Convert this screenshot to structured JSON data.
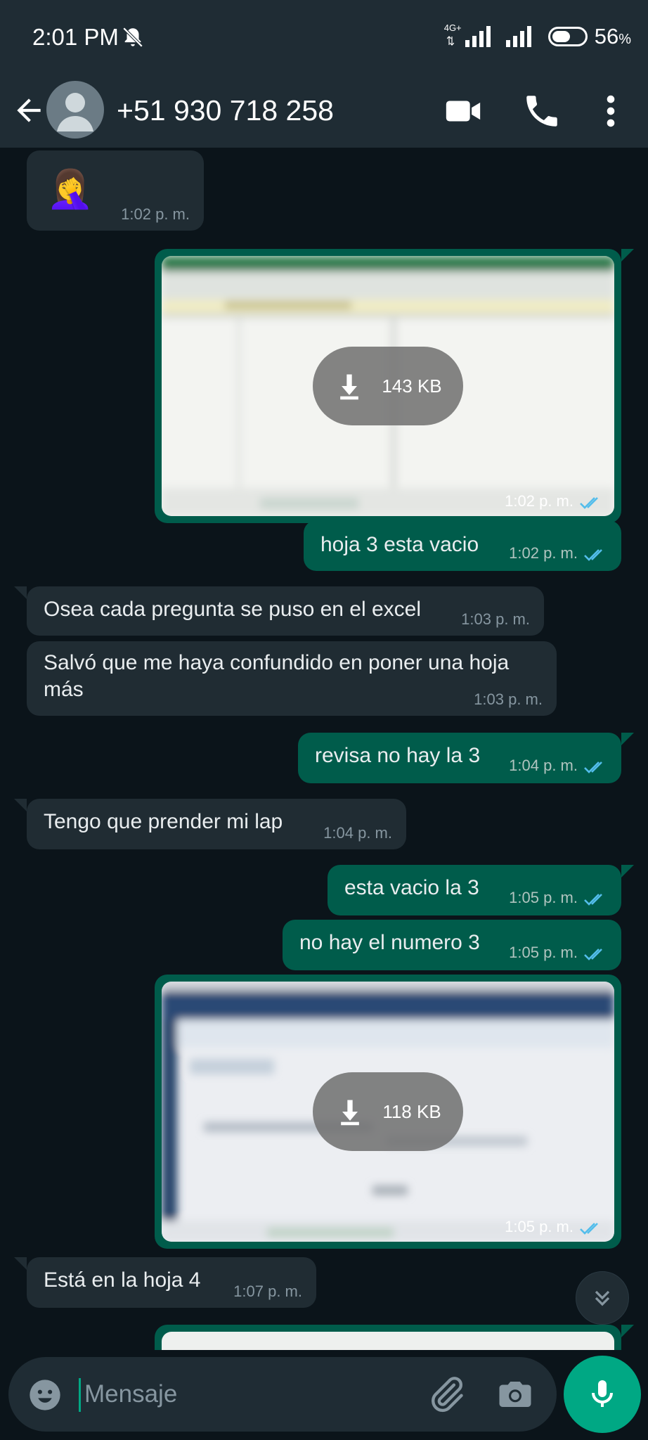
{
  "status_bar": {
    "time": "2:01 PM",
    "network": "4G+",
    "battery": "56",
    "battery_unit": "%",
    "battery_level_percent": 56,
    "icons": [
      "bell-muted-icon",
      "signal-icon",
      "signal-icon",
      "battery-icon"
    ]
  },
  "header": {
    "contact": "+51 930 718 258",
    "icons": [
      "back-arrow-icon",
      "avatar",
      "video-call-icon",
      "phone-icon",
      "more-vert-icon"
    ]
  },
  "messages": [
    {
      "dir": "in",
      "type": "emoji",
      "text": "🤦‍♀️",
      "time": "1:02 p. m."
    },
    {
      "dir": "out",
      "type": "image",
      "size": "143 KB",
      "time": "1:02 p. m."
    },
    {
      "dir": "out",
      "type": "text",
      "text": "hoja 3 esta vacio",
      "time": "1:02 p. m."
    },
    {
      "dir": "in",
      "type": "text",
      "text": "Osea cada pregunta se puso en el excel",
      "time": "1:03 p. m."
    },
    {
      "dir": "in",
      "type": "text",
      "text": "Salvó que me haya confundido en poner una hoja",
      "text2": "más",
      "time": "1:03 p. m."
    },
    {
      "dir": "out",
      "type": "text",
      "text": "revisa no hay la 3",
      "time": "1:04 p. m."
    },
    {
      "dir": "in",
      "type": "text",
      "text": "Tengo que prender mi lap",
      "time": "1:04 p. m."
    },
    {
      "dir": "out",
      "type": "text",
      "text": "esta vacio la 3",
      "time": "1:05 p. m."
    },
    {
      "dir": "out",
      "type": "text",
      "text": "no hay el numero 3",
      "time": "1:05 p. m."
    },
    {
      "dir": "out",
      "type": "image",
      "size": "118 KB",
      "time": "1:05 p. m."
    },
    {
      "dir": "in",
      "type": "text",
      "text": "Está en la hoja 4",
      "time": "1:07 p. m."
    }
  ],
  "composer": {
    "placeholder": "Mensaje",
    "icons": [
      "emoji-icon",
      "attach-icon",
      "camera-icon",
      "mic-icon"
    ]
  },
  "colors": {
    "background": "#0b141a",
    "bar": "#1f2c34",
    "incoming_bubble": "#202c33",
    "outgoing_bubble": "#005c4b",
    "accent": "#00a884",
    "read_ticks": "#53bdeb"
  }
}
